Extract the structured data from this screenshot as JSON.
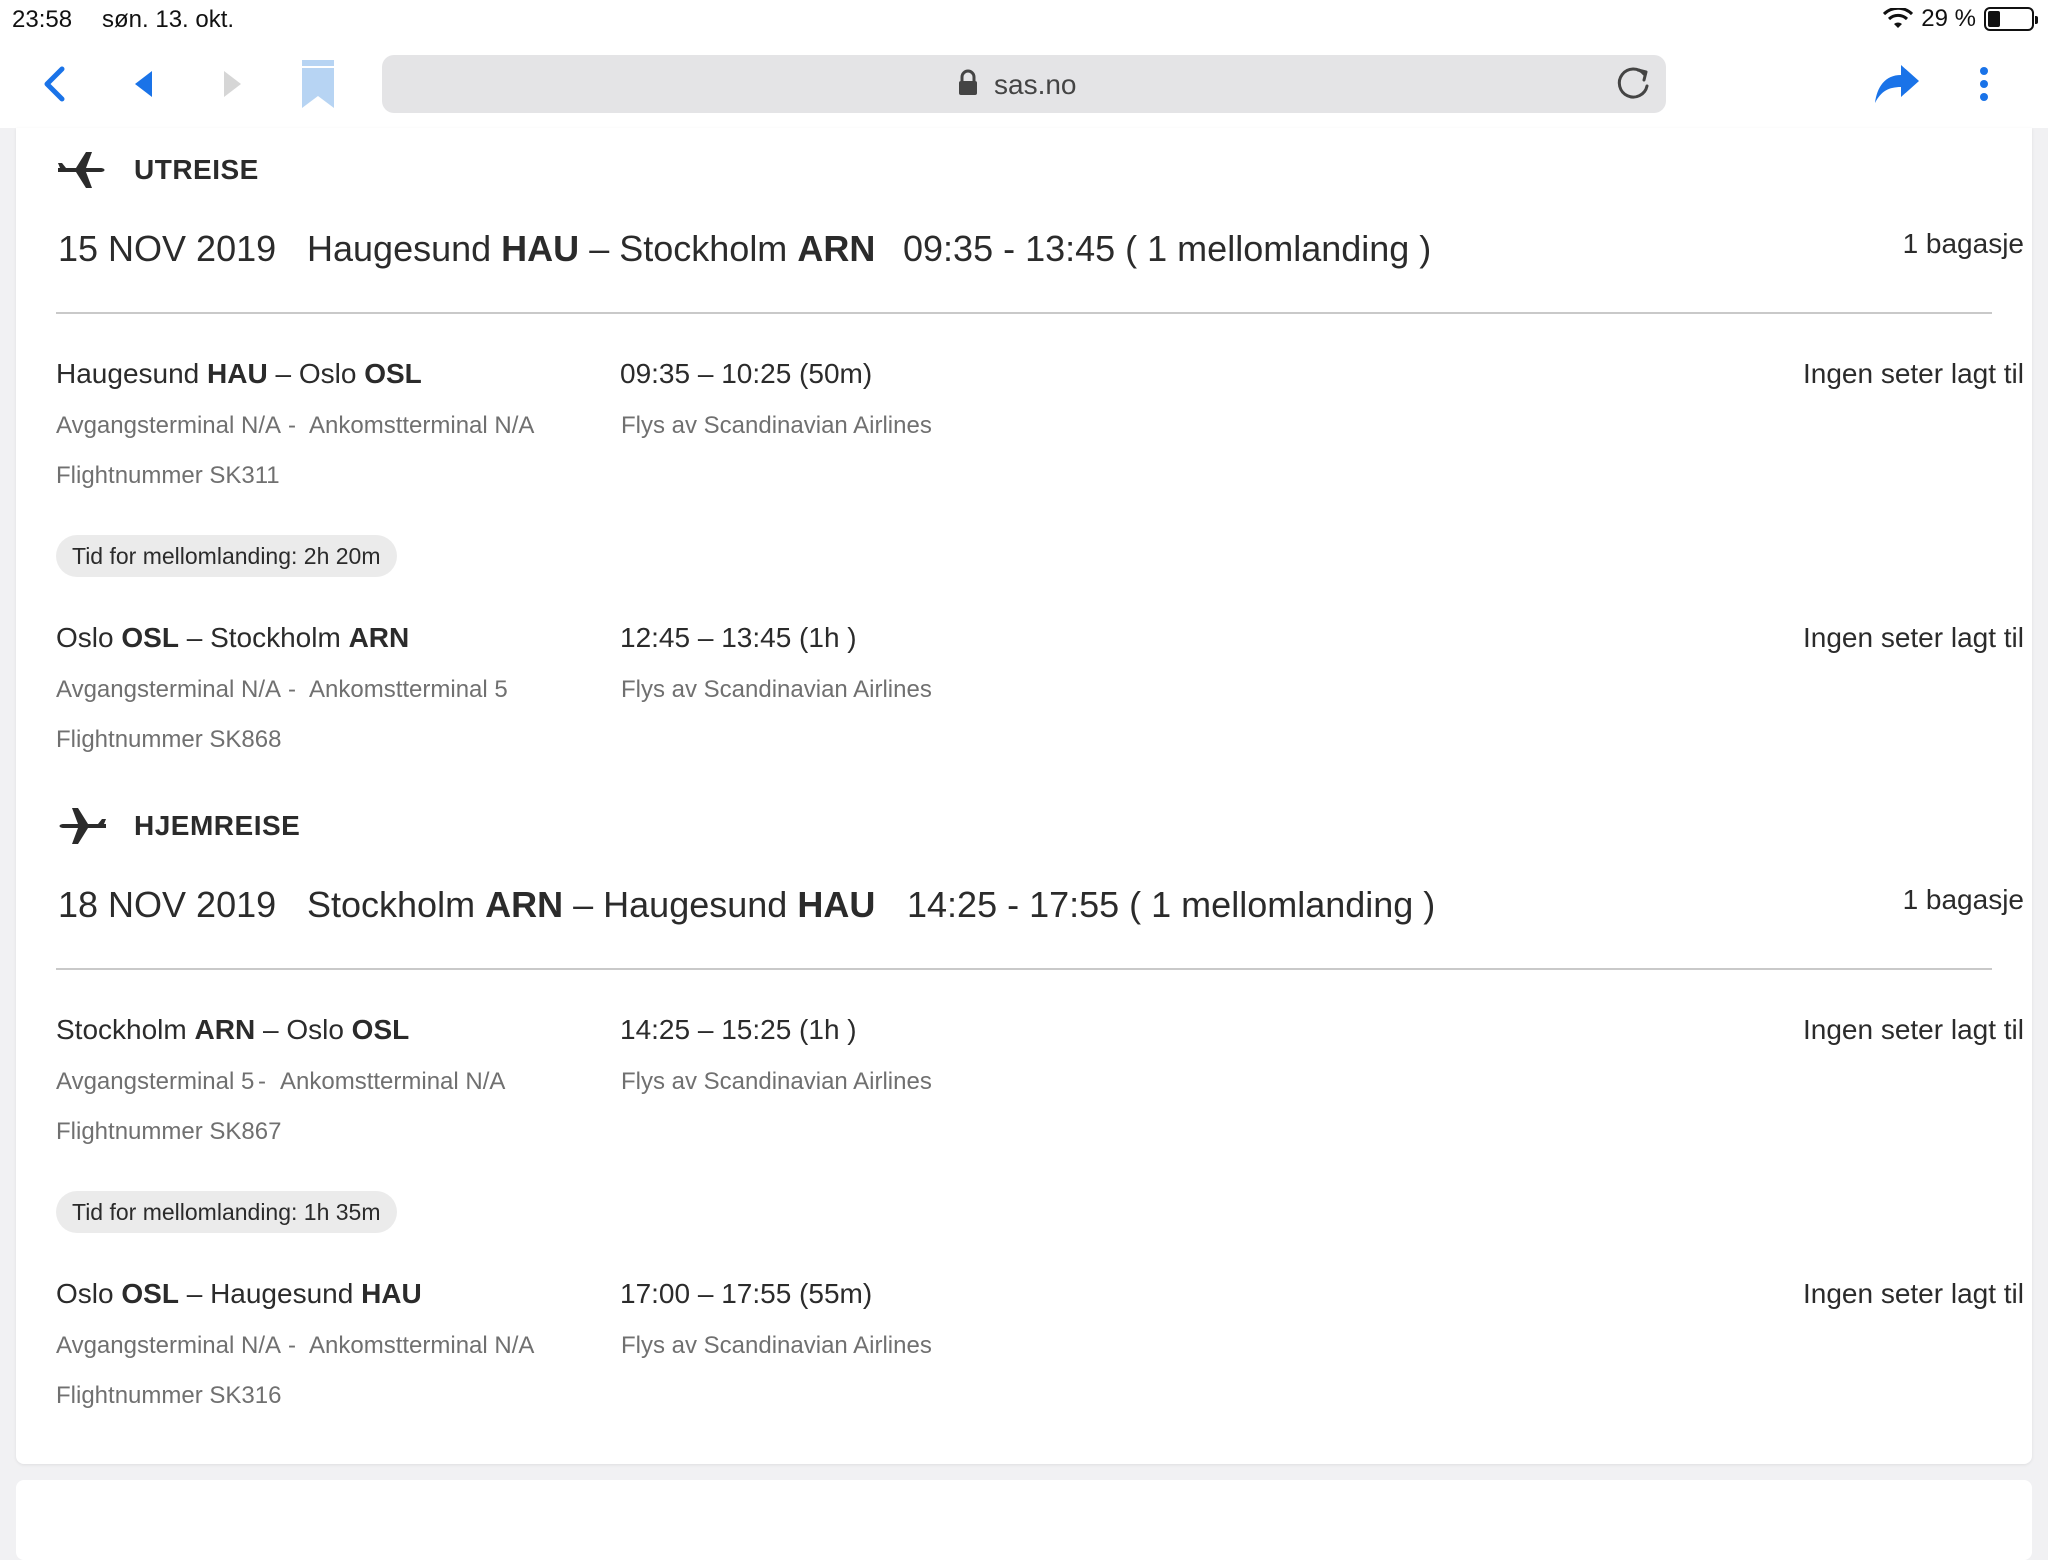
{
  "status_bar": {
    "time": "23:58",
    "date": "søn. 13. okt.",
    "battery": "29 %",
    "battery_level": 0.29
  },
  "browser": {
    "url": "sas.no",
    "accent_color": "#1a73e8",
    "icons": [
      "back-icon",
      "prev-icon",
      "next-icon",
      "bookmark-icon",
      "lock-icon",
      "reload-icon",
      "share-icon",
      "menu-icon"
    ]
  },
  "outbound": {
    "label": "UTREISE",
    "date": "15 NOV 2019",
    "from_city": "Haugesund",
    "from_code": "HAU",
    "to_city": "Stockholm",
    "to_code": "ARN",
    "dash": "–",
    "time_summary": "09:35 - 13:45 ( 1 mellomlanding )",
    "baggage": "1 bagasje",
    "legs": [
      {
        "from_city": "Haugesund",
        "from_code": "HAU",
        "to_city": "Oslo",
        "to_code": "OSL",
        "time": "09:35 – 10:25 (50m)",
        "dep_terminal": "Avgangsterminal N/A",
        "arr_terminal": "Ankomstterminal N/A",
        "flight_number": "Flightnummer SK311",
        "operator": "Flys av Scandinavian Airlines",
        "seats": "Ingen seter lagt til"
      },
      {
        "from_city": "Oslo",
        "from_code": "OSL",
        "to_city": "Stockholm",
        "to_code": "ARN",
        "time": "12:45 – 13:45 (1h )",
        "dep_terminal": "Avgangsterminal N/A",
        "arr_terminal": "Ankomstterminal 5",
        "flight_number": "Flightnummer SK868",
        "operator": "Flys av Scandinavian Airlines",
        "seats": "Ingen seter lagt til"
      }
    ],
    "layover": "Tid for mellomlanding: 2h 20m"
  },
  "return": {
    "label": "HJEMREISE",
    "date": "18 NOV 2019",
    "from_city": "Stockholm",
    "from_code": "ARN",
    "to_city": "Haugesund",
    "to_code": "HAU",
    "dash": "–",
    "time_summary": "14:25 - 17:55 ( 1 mellomlanding )",
    "baggage": "1 bagasje",
    "legs": [
      {
        "from_city": "Stockholm",
        "from_code": "ARN",
        "to_city": "Oslo",
        "to_code": "OSL",
        "time": "14:25 – 15:25 (1h )",
        "dep_terminal": "Avgangsterminal 5",
        "arr_terminal": "Ankomstterminal N/A",
        "flight_number": "Flightnummer SK867",
        "operator": "Flys av Scandinavian Airlines",
        "seats": "Ingen seter lagt til"
      },
      {
        "from_city": "Oslo",
        "from_code": "OSL",
        "to_city": "Haugesund",
        "to_code": "HAU",
        "time": "17:00 – 17:55 (55m)",
        "dep_terminal": "Avgangsterminal N/A",
        "arr_terminal": "Ankomstterminal N/A",
        "flight_number": "Flightnummer SK316",
        "operator": "Flys av Scandinavian Airlines",
        "seats": "Ingen seter lagt til"
      }
    ],
    "layover": "Tid for mellomlanding: 1h 35m"
  },
  "separator": "-"
}
